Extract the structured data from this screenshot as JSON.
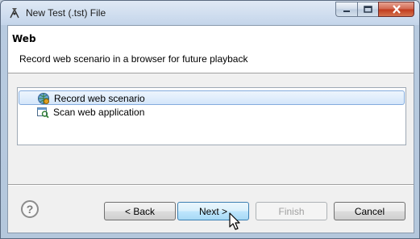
{
  "window": {
    "title": "New Test (.tst) File"
  },
  "header": {
    "title": "Web",
    "description": "Record web scenario in a browser for future playback"
  },
  "options": [
    {
      "label": "Record web scenario",
      "icon": "record-web-icon",
      "selected": true
    },
    {
      "label": "Scan web application",
      "icon": "scan-web-icon",
      "selected": false
    }
  ],
  "buttons": {
    "back": "< Back",
    "next": "Next >",
    "finish": "Finish",
    "cancel": "Cancel"
  },
  "help": {
    "symbol": "?"
  }
}
